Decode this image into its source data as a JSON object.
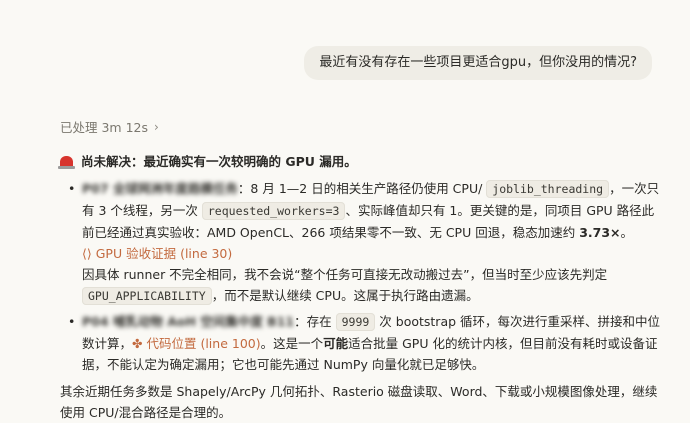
{
  "user_message": "最近有没有存在一些项目更适合gpu，但你没用的情况?",
  "processed": {
    "label": "已处理 3m 12s",
    "chevron_icon": "chevron-right-icon"
  },
  "heading": {
    "icon": "siren-icon",
    "text": "尚未解决：最近确实有一次较明确的 GPU 漏用。"
  },
  "bullet1": {
    "title_blurred": "P07 全球网洲年度趋模任务",
    "t1": "：8 月 1—2 日的相关生产路径仍使用 CPU/ ",
    "code1": "joblib_threading",
    "t2": "，一次只有 3 个线程，另一次 ",
    "code2": "requested_workers=3",
    "t3": "、实际峰值却只有 1。更关键的是，同项目 GPU 路径此前已经通过真实验收：AMD OpenCL、266 项结果零不一致、无 CPU 回退，稳态加速约 ",
    "speedup": "3.73×",
    "t3b": "。",
    "cite_icon": "code-braces-icon",
    "cite_label": "GPU 验收证据 (line 30)",
    "t4": "因具体 runner 不完全相同，我不会说“整个任务可直接无改动搬过去”，但当时至少应该先判定 ",
    "code3": "GPU_APPLICABILITY",
    "t5": "，而不是默认继续 CPU。这属于执行路由遗漏。"
  },
  "bullet2": {
    "title_blurred": "P04 哺乳动物 AoH 空间集中度 B11",
    "t1": "：存在 ",
    "code1": "9999",
    "t2": " 次 bootstrap 循环，每次进行重采样、拼接和中位数计算，",
    "cite_icon": "code-snippet-icon",
    "cite_label": "代码位置 (line 100)",
    "t3": "。这是一个",
    "bold": "可能",
    "t4": "适合批量 GPU 化的统计内核，但目前没有耗时或设备证据，不能认定为确定漏用；它也可能先通过 NumPy 向量化就已足够快。"
  },
  "conclusion": "其余近期任务多数是 Shapely/ArcPy 几何拓扑、Rasterio 磁盘读取、Word、下载或小规模图像处理，继续使用 CPU/混合路径是合理的。"
}
